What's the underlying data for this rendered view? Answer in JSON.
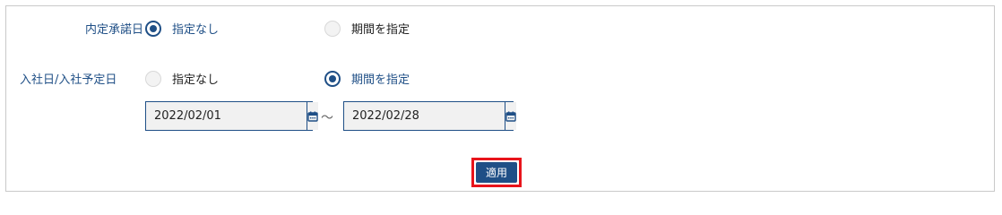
{
  "filters": {
    "acceptance_date": {
      "label": "内定承諾日",
      "option_none": "指定なし",
      "option_range": "期間を指定",
      "selected": "none"
    },
    "join_date": {
      "label": "入社日/入社予定日",
      "option_none": "指定なし",
      "option_range": "期間を指定",
      "selected": "range",
      "from": "2022/02/01",
      "separator": "〜",
      "to": "2022/02/28"
    }
  },
  "actions": {
    "apply_label": "適用"
  },
  "colors": {
    "accent": "#1f4f86",
    "highlight": "#e8141b"
  }
}
